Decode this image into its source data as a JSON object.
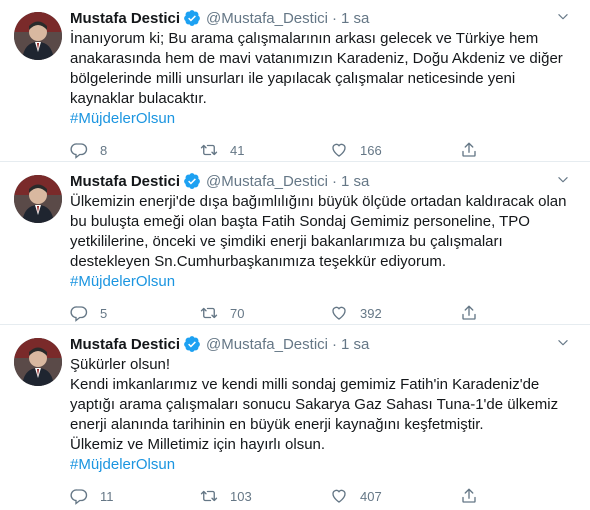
{
  "tweets": [
    {
      "name": "Mustafa Destici",
      "handle": "@Mustafa_Destici",
      "dot": "·",
      "time": "1 sa",
      "text": "İnanıyorum ki; Bu arama çalışmalarının arkası gelecek ve Türkiye hem\nanakarasında hem de mavi vatanımızın Karadeniz, Doğu Akdeniz ve diğer\nbölgelerinde milli unsurları ile yapılacak çalışmalar neticesinde yeni\nkaynaklar bulacaktır.",
      "hashtag": "#MüjdelerOlsun",
      "replies": "8",
      "retweets": "41",
      "likes": "166"
    },
    {
      "name": "Mustafa Destici",
      "handle": "@Mustafa_Destici",
      "dot": "·",
      "time": "1 sa",
      "text": "Ülkemizin enerji'de dışa bağımlılığını büyük ölçüde ortadan kaldıracak olan\nbu buluşta emeği olan başta Fatih Sondaj Gemimiz personeline, TPO\nyetkililerine, önceki ve şimdiki enerji bakanlarımıza bu çalışmaları\ndestekleyen Sn.Cumhurbaşkanımıza teşekkür ediyorum.",
      "hashtag": "#MüjdelerOlsun",
      "replies": "5",
      "retweets": "70",
      "likes": "392"
    },
    {
      "name": "Mustafa Destici",
      "handle": "@Mustafa_Destici",
      "dot": "·",
      "time": "1 sa",
      "text": "Şükürler olsun!\nKendi imkanlarımız ve kendi milli sondaj gemimiz Fatih'in Karadeniz'de\nyaptığı arama çalışmaları sonucu Sakarya Gaz Sahası Tuna-1'de ülkemiz\nenerji alanında tarihinin en büyük enerji kaynağını keşfetmiştir.\nÜlkemiz ve Milletimiz için hayırlı olsun.",
      "hashtag": "#MüjdelerOlsun",
      "replies": "11",
      "retweets": "103",
      "likes": "407"
    }
  ],
  "icons": {
    "verified": "verified-badge-icon",
    "caret": "chevron-down-icon",
    "reply": "reply-icon",
    "retweet": "retweet-icon",
    "like": "heart-icon",
    "share": "share-icon"
  },
  "colors": {
    "accent": "#1da1f2",
    "hashtag": "#1b95e0",
    "muted": "#657786",
    "text": "#14171a",
    "divider": "#e6ecf0"
  }
}
